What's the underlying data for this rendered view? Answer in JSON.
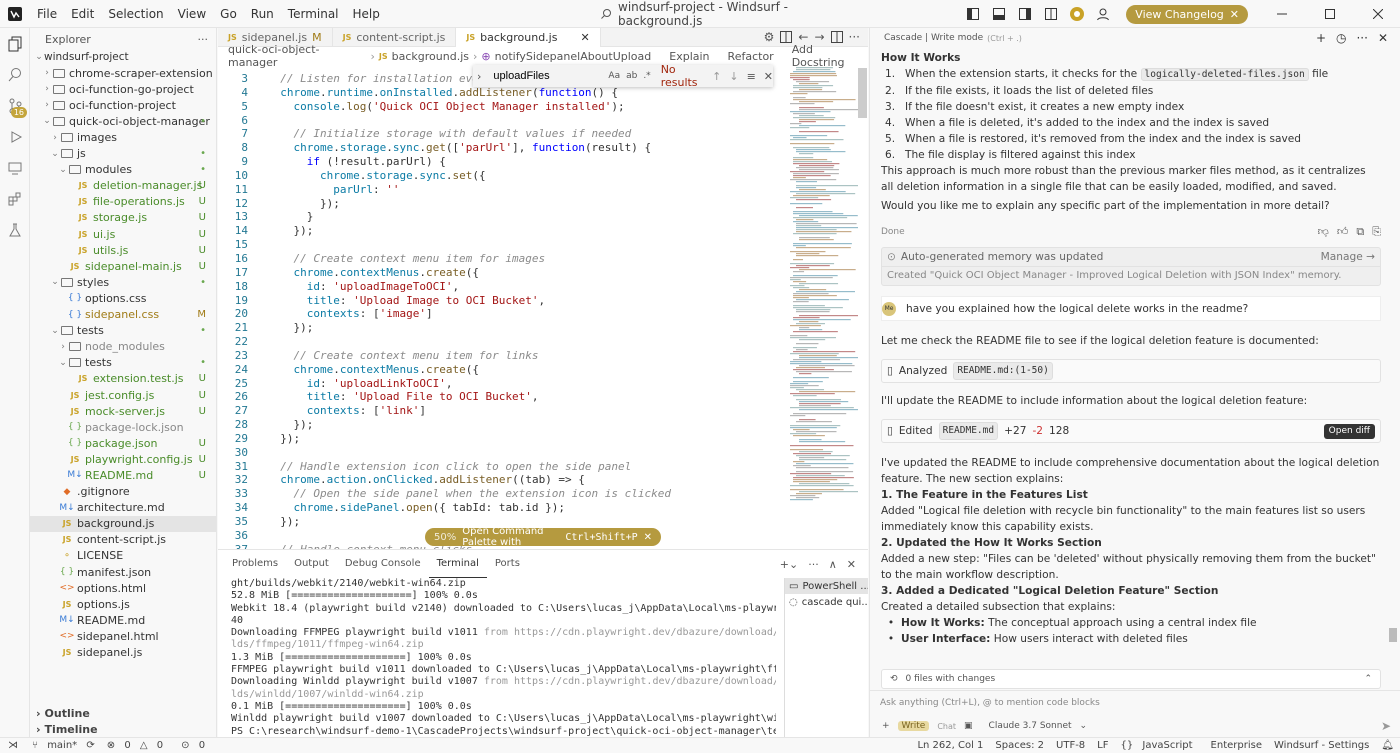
{
  "menu": [
    "File",
    "Edit",
    "Selection",
    "View",
    "Go",
    "Run",
    "Terminal",
    "Help"
  ],
  "window_title": "windsurf-project - Windsurf - background.js",
  "changelog_label": "View Changelog",
  "explorer": {
    "title": "Explorer",
    "root": "windsurf-project",
    "tree": [
      {
        "d": 1,
        "t": "folder",
        "n": "chrome-scraper-extension",
        "o": false,
        "s": ""
      },
      {
        "d": 1,
        "t": "folder",
        "n": "oci-function-go-project",
        "o": false,
        "s": ""
      },
      {
        "d": 1,
        "t": "folder",
        "n": "oci-function-project",
        "o": false,
        "s": ""
      },
      {
        "d": 1,
        "t": "folder",
        "n": "quick-oci-object-manager",
        "o": true,
        "s": "•",
        "c": "dot"
      },
      {
        "d": 2,
        "t": "folder",
        "n": "images",
        "o": false,
        "s": ""
      },
      {
        "d": 2,
        "t": "folder",
        "n": "js",
        "o": true,
        "s": "•",
        "c": "dot"
      },
      {
        "d": 3,
        "t": "folder",
        "n": "modules",
        "o": true,
        "s": "•",
        "c": "dot"
      },
      {
        "d": 4,
        "t": "js",
        "n": "deletion-manager.js",
        "s": "U",
        "c": "U"
      },
      {
        "d": 4,
        "t": "js",
        "n": "file-operations.js",
        "s": "U",
        "c": "U"
      },
      {
        "d": 4,
        "t": "js",
        "n": "storage.js",
        "s": "U",
        "c": "U"
      },
      {
        "d": 4,
        "t": "js",
        "n": "ui.js",
        "s": "U",
        "c": "U"
      },
      {
        "d": 4,
        "t": "js",
        "n": "utils.js",
        "s": "U",
        "c": "U"
      },
      {
        "d": 3,
        "t": "js",
        "n": "sidepanel-main.js",
        "s": "U",
        "c": "U"
      },
      {
        "d": 2,
        "t": "folder",
        "n": "styles",
        "o": true,
        "s": "•",
        "c": "dot"
      },
      {
        "d": 3,
        "t": "css",
        "n": "options.css",
        "s": "",
        "c": ""
      },
      {
        "d": 3,
        "t": "css",
        "n": "sidepanel.css",
        "s": "M",
        "c": "M"
      },
      {
        "d": 2,
        "t": "folder",
        "n": "tests",
        "o": true,
        "s": "•",
        "c": "dot"
      },
      {
        "d": 3,
        "t": "folder",
        "n": "node_modules",
        "o": false,
        "s": "",
        "g": true
      },
      {
        "d": 3,
        "t": "folder",
        "n": "tests",
        "o": true,
        "s": "•",
        "c": "dot"
      },
      {
        "d": 4,
        "t": "js",
        "n": "extension.test.js",
        "s": "U",
        "c": "U"
      },
      {
        "d": 3,
        "t": "js",
        "n": "jest.config.js",
        "s": "U",
        "c": "U"
      },
      {
        "d": 3,
        "t": "js",
        "n": "mock-server.js",
        "s": "U",
        "c": "U"
      },
      {
        "d": 3,
        "t": "json",
        "n": "package-lock.json",
        "s": "",
        "c": "",
        "g": true
      },
      {
        "d": 3,
        "t": "json",
        "n": "package.json",
        "s": "U",
        "c": "U"
      },
      {
        "d": 3,
        "t": "js",
        "n": "playwright.config.js",
        "s": "U",
        "c": "U"
      },
      {
        "d": 3,
        "t": "md",
        "n": "README.md",
        "s": "U",
        "c": "U"
      },
      {
        "d": 2,
        "t": "git",
        "n": ".gitignore",
        "s": "",
        "c": ""
      },
      {
        "d": 2,
        "t": "md",
        "n": "architecture.md",
        "s": "",
        "c": ""
      },
      {
        "d": 2,
        "t": "js",
        "n": "background.js",
        "s": "",
        "c": "",
        "sel": true
      },
      {
        "d": 2,
        "t": "js",
        "n": "content-script.js",
        "s": "",
        "c": ""
      },
      {
        "d": 2,
        "t": "lic",
        "n": "LICENSE",
        "s": "",
        "c": ""
      },
      {
        "d": 2,
        "t": "json",
        "n": "manifest.json",
        "s": "",
        "c": ""
      },
      {
        "d": 2,
        "t": "html",
        "n": "options.html",
        "s": "",
        "c": ""
      },
      {
        "d": 2,
        "t": "js",
        "n": "options.js",
        "s": "",
        "c": ""
      },
      {
        "d": 2,
        "t": "md",
        "n": "README.md",
        "s": "",
        "c": ""
      },
      {
        "d": 2,
        "t": "html",
        "n": "sidepanel.html",
        "s": "",
        "c": ""
      },
      {
        "d": 2,
        "t": "js",
        "n": "sidepanel.js",
        "s": "",
        "c": ""
      }
    ],
    "outline": "Outline",
    "timeline": "Timeline"
  },
  "tabs": [
    {
      "label": "sidepanel.js",
      "status": "M",
      "active": false
    },
    {
      "label": "content-script.js",
      "status": "",
      "active": false
    },
    {
      "label": "background.js",
      "status": "",
      "active": true
    }
  ],
  "breadcrumb": [
    "quick-oci-object-manager",
    "background.js",
    "notifySidepanelAboutUpload"
  ],
  "breadcrumb_actions": [
    "Explain",
    "Refactor",
    "Add Docstring"
  ],
  "find": {
    "value": "uploadFiles",
    "result": "No results"
  },
  "code": [
    {
      "n": "3",
      "h": [
        [
          "cm",
          "  // Listen for installation event"
        ]
      ]
    },
    {
      "n": "4",
      "h": [
        [
          "ob",
          "  chrome"
        ],
        [
          "pl",
          "."
        ],
        [
          "ob",
          "runtime"
        ],
        [
          "pl",
          "."
        ],
        [
          "ob",
          "onInstalled"
        ],
        [
          "pl",
          "."
        ],
        [
          "fn",
          "addListener"
        ],
        [
          "pl",
          "("
        ],
        [
          "kw",
          "function"
        ],
        [
          "pl",
          "() {"
        ]
      ]
    },
    {
      "n": "5",
      "h": [
        [
          "ob",
          "    console"
        ],
        [
          "pl",
          "."
        ],
        [
          "fn",
          "log"
        ],
        [
          "pl",
          "("
        ],
        [
          "sr",
          "'Quick OCI Object Manager installed'"
        ],
        [
          "pl",
          ");"
        ]
      ]
    },
    {
      "n": "6",
      "h": []
    },
    {
      "n": "7",
      "h": [
        [
          "cm",
          "    // Initialize storage with default values if needed"
        ]
      ]
    },
    {
      "n": "8",
      "h": [
        [
          "ob",
          "    chrome"
        ],
        [
          "pl",
          "."
        ],
        [
          "ob",
          "storage"
        ],
        [
          "pl",
          "."
        ],
        [
          "ob",
          "sync"
        ],
        [
          "pl",
          "."
        ],
        [
          "fn",
          "get"
        ],
        [
          "pl",
          "(["
        ],
        [
          "sr",
          "'parUrl'"
        ],
        [
          "pl",
          "], "
        ],
        [
          "kw",
          "function"
        ],
        [
          "pl",
          "(result) {"
        ]
      ]
    },
    {
      "n": "9",
      "h": [
        [
          "kw",
          "      if"
        ],
        [
          "pl",
          " (!result.parUrl) {"
        ]
      ]
    },
    {
      "n": "10",
      "h": [
        [
          "ob",
          "        chrome"
        ],
        [
          "pl",
          "."
        ],
        [
          "ob",
          "storage"
        ],
        [
          "pl",
          "."
        ],
        [
          "ob",
          "sync"
        ],
        [
          "pl",
          "."
        ],
        [
          "fn",
          "set"
        ],
        [
          "pl",
          "({"
        ]
      ]
    },
    {
      "n": "11",
      "h": [
        [
          "ob",
          "          parUrl"
        ],
        [
          "pl",
          ": "
        ],
        [
          "sr",
          "''"
        ]
      ]
    },
    {
      "n": "12",
      "h": [
        [
          "pl",
          "        });"
        ]
      ]
    },
    {
      "n": "13",
      "h": [
        [
          "pl",
          "      }"
        ]
      ]
    },
    {
      "n": "14",
      "h": [
        [
          "pl",
          "    });"
        ]
      ]
    },
    {
      "n": "15",
      "h": []
    },
    {
      "n": "16",
      "h": [
        [
          "cm",
          "    // Create context menu item for images"
        ]
      ]
    },
    {
      "n": "17",
      "h": [
        [
          "ob",
          "    chrome"
        ],
        [
          "pl",
          "."
        ],
        [
          "ob",
          "contextMenus"
        ],
        [
          "pl",
          "."
        ],
        [
          "fn",
          "create"
        ],
        [
          "pl",
          "({"
        ]
      ]
    },
    {
      "n": "18",
      "h": [
        [
          "ob",
          "      id"
        ],
        [
          "pl",
          ": "
        ],
        [
          "sr",
          "'uploadImageToOCI'"
        ],
        [
          "pl",
          ","
        ]
      ]
    },
    {
      "n": "19",
      "h": [
        [
          "ob",
          "      title"
        ],
        [
          "pl",
          ": "
        ],
        [
          "sr",
          "'Upload Image to OCI Bucket'"
        ],
        [
          "pl",
          ","
        ]
      ]
    },
    {
      "n": "20",
      "h": [
        [
          "ob",
          "      contexts"
        ],
        [
          "pl",
          ": ["
        ],
        [
          "sr",
          "'image'"
        ],
        [
          "pl",
          "]"
        ]
      ]
    },
    {
      "n": "21",
      "h": [
        [
          "pl",
          "    });"
        ]
      ]
    },
    {
      "n": "22",
      "h": []
    },
    {
      "n": "23",
      "h": [
        [
          "cm",
          "    // Create context menu item for links"
        ]
      ]
    },
    {
      "n": "24",
      "h": [
        [
          "ob",
          "    chrome"
        ],
        [
          "pl",
          "."
        ],
        [
          "ob",
          "contextMenus"
        ],
        [
          "pl",
          "."
        ],
        [
          "fn",
          "create"
        ],
        [
          "pl",
          "({"
        ]
      ]
    },
    {
      "n": "25",
      "h": [
        [
          "ob",
          "      id"
        ],
        [
          "pl",
          ": "
        ],
        [
          "sr",
          "'uploadLinkToOCI'"
        ],
        [
          "pl",
          ","
        ]
      ]
    },
    {
      "n": "26",
      "h": [
        [
          "ob",
          "      title"
        ],
        [
          "pl",
          ": "
        ],
        [
          "sr",
          "'Upload File to OCI Bucket'"
        ],
        [
          "pl",
          ","
        ]
      ]
    },
    {
      "n": "27",
      "h": [
        [
          "ob",
          "      contexts"
        ],
        [
          "pl",
          ": ["
        ],
        [
          "sr",
          "'link'"
        ],
        [
          "pl",
          "]"
        ]
      ]
    },
    {
      "n": "28",
      "h": [
        [
          "pl",
          "    });"
        ]
      ]
    },
    {
      "n": "29",
      "h": [
        [
          "pl",
          "  });"
        ]
      ]
    },
    {
      "n": "30",
      "h": []
    },
    {
      "n": "31",
      "h": [
        [
          "cm",
          "  // Handle extension icon click to open the side panel"
        ]
      ]
    },
    {
      "n": "32",
      "h": [
        [
          "ob",
          "  chrome"
        ],
        [
          "pl",
          "."
        ],
        [
          "ob",
          "action"
        ],
        [
          "pl",
          "."
        ],
        [
          "ob",
          "onClicked"
        ],
        [
          "pl",
          "."
        ],
        [
          "fn",
          "addListener"
        ],
        [
          "pl",
          "((tab) => {"
        ]
      ]
    },
    {
      "n": "33",
      "h": [
        [
          "cm",
          "    // Open the side panel when the extension icon is clicked"
        ]
      ]
    },
    {
      "n": "34",
      "h": [
        [
          "ob",
          "    chrome"
        ],
        [
          "pl",
          "."
        ],
        [
          "ob",
          "sidePanel"
        ],
        [
          "pl",
          "."
        ],
        [
          "fn",
          "open"
        ],
        [
          "pl",
          "({ tabId: tab.id });"
        ]
      ]
    },
    {
      "n": "35",
      "h": [
        [
          "pl",
          "  });"
        ]
      ]
    },
    {
      "n": "36",
      "h": []
    },
    {
      "n": "37",
      "h": [
        [
          "cm",
          "  // Handle context menu clicks"
        ]
      ]
    }
  ],
  "palette_toast": {
    "percent": "50%",
    "text": "Open Command Palette with",
    "keys": "Ctrl+Shift+P"
  },
  "panel": {
    "tabs": [
      "Problems",
      "Output",
      "Debug Console",
      "Terminal",
      "Ports"
    ],
    "active": "Terminal",
    "lines": [
      {
        "t": "ght/builds/webkit/2140/webkit-win64.zip"
      },
      {
        "t": "52.8 MiB [====================] 100% 0.0s"
      },
      {
        "t": "Webkit 18.4 (playwright build v2140) downloaded to C:\\Users\\lucas_j\\AppData\\Local\\ms-playwright\\webkit-21"
      },
      {
        "t": "40"
      },
      {
        "t": "Downloading FFMPEG playwright build v1011 ",
        "u": "from https://cdn.playwright.dev/dbazure/download/playwright/bui"
      },
      {
        "t": "",
        "u": "lds/ffmpeg/1011/ffmpeg-win64.zip"
      },
      {
        "t": "1.3 MiB [====================] 100% 0.0s"
      },
      {
        "t": "FFMPEG playwright build v1011 downloaded to C:\\Users\\lucas_j\\AppData\\Local\\ms-playwright\\ffmpeg-1011"
      },
      {
        "t": "Downloading Winldd playwright build v1007 ",
        "u": "from https://cdn.playwright.dev/dbazure/download/playwright/bui"
      },
      {
        "t": "",
        "u": "lds/winldd/1007/winldd-win64.zip"
      },
      {
        "t": "0.1 MiB [====================] 100% 0.0s"
      },
      {
        "t": "Winldd playwright build v1007 downloaded to C:\\Users\\lucas_j\\AppData\\Local\\ms-playwright\\winldd-1007"
      },
      {
        "t": "PS C:\\research\\windsurf-demo-1\\CascadeProjects\\windsurf-project\\quick-oci-object-manager\\tests> "
      }
    ],
    "terminals": [
      "PowerShell ...",
      "cascade  qui..."
    ]
  },
  "status": {
    "branch": "main*",
    "errors": "0",
    "warnings": "0",
    "ports": "0",
    "position": "Ln 262, Col 1",
    "spaces": "Spaces: 2",
    "encoding": "UTF-8",
    "eol": "LF",
    "lang": "JavaScript",
    "ent": "Enterprise",
    "settings": "Windsurf - Settings"
  },
  "cascade": {
    "title": "Cascade | Write mode",
    "shortcut": "(Ctrl + .)",
    "how_title": "How It Works",
    "steps": [
      [
        "When the extension starts, it checks for the ",
        "logically-deleted-files.json",
        " file"
      ],
      [
        "If the file exists, it loads the list of deleted files",
        "",
        ""
      ],
      [
        "If the file doesn't exist, it creates a new empty index",
        "",
        ""
      ],
      [
        "When a file is deleted, it's added to the index and the index is saved",
        "",
        ""
      ],
      [
        "When a file is restored, it's removed from the index and the index is saved",
        "",
        ""
      ],
      [
        "The file display is filtered against this index",
        "",
        ""
      ]
    ],
    "p1": "This approach is much more robust than the previous marker files method, as it centralizes all deletion information in a single file that can be easily loaded, modified, and saved.",
    "p2": "Would you like me to explain any specific part of the implementation in more detail?",
    "done": "Done",
    "memory_title": "Auto-generated memory was updated",
    "memory_manage": "Manage",
    "memory_detail": "Created \"Quick OCI Object Manager - Improved Logical Deletion with JSON Index\" memory.",
    "user_initials": "Me",
    "user_msg": "have you explained how the logical delete works in the readme?",
    "p3": "Let me check the README file to see if the logical deletion feature is documented:",
    "analyzed": "Analyzed",
    "analyzed_file": "README.md:(1-50)",
    "p4": "I'll update the README to include information about the logical deletion feature:",
    "edited": "Edited",
    "edited_file": "README.md",
    "added": "+27",
    "removed": "-2",
    "lines": "128",
    "open_diff": "Open diff",
    "p5": "I've updated the README to include comprehensive documentation about the logical deletion feature. The new section explains:",
    "s1": "1. The Feature in the Features List",
    "s1t": "Added \"Logical file deletion with recycle bin functionality\" to the main features list so users immediately know this capability exists.",
    "s2": "2. Updated the How It Works Section",
    "s2t": "Added a new step: \"Files can be 'deleted' without physically removing them from the bucket\" to the main workflow description.",
    "s3": "3. Added a Dedicated \"Logical Deletion Feature\" Section",
    "s3t": "Created a detailed subsection that explains:",
    "bullets": [
      [
        "How It Works:",
        " The conceptual approach using a central index file"
      ],
      [
        "User Interface:",
        " How users interact with deleted files"
      ]
    ],
    "files_changed": "0 files with changes",
    "input_placeholder": "Ask anything (Ctrl+L), @ to mention code blocks",
    "write": "Write",
    "chat": "Chat",
    "model": "Claude 3.7 Sonnet"
  }
}
